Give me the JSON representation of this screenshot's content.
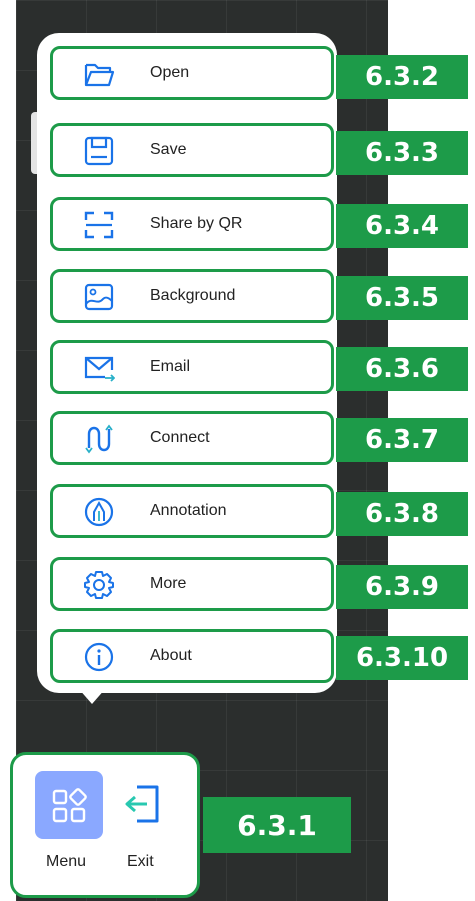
{
  "colors": {
    "highlight_green": "#1d9b49",
    "icon_blue": "#1a73e8",
    "menu_button_bg": "#8aa8ff",
    "canvas_dark": "#2b2e2d"
  },
  "menu": {
    "items": [
      {
        "label": "Open",
        "icon": "folder-icon",
        "tag": "6.3.2"
      },
      {
        "label": "Save",
        "icon": "save-icon",
        "tag": "6.3.3"
      },
      {
        "label": "Share by QR",
        "icon": "qr-scan-icon",
        "tag": "6.3.4"
      },
      {
        "label": "Background",
        "icon": "image-icon",
        "tag": "6.3.5"
      },
      {
        "label": "Email",
        "icon": "mail-icon",
        "tag": "6.3.6"
      },
      {
        "label": "Connect",
        "icon": "connect-icon",
        "tag": "6.3.7"
      },
      {
        "label": "Annotation",
        "icon": "pen-icon",
        "tag": "6.3.8"
      },
      {
        "label": "More",
        "icon": "gear-icon",
        "tag": "6.3.9"
      },
      {
        "label": "About",
        "icon": "info-icon",
        "tag": "6.3.10"
      }
    ]
  },
  "dock": {
    "menu_label": "Menu",
    "menu_icon": "apps-icon",
    "exit_label": "Exit",
    "exit_icon": "exit-icon",
    "tag": "6.3.1"
  }
}
